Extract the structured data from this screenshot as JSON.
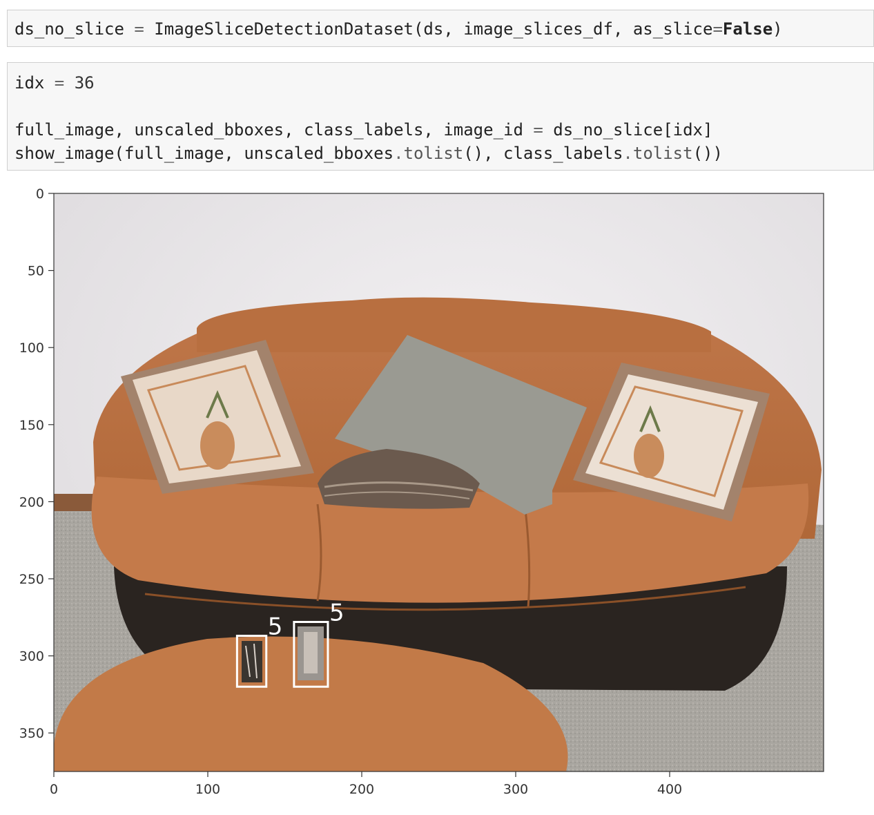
{
  "cells": [
    {
      "id": "cell1",
      "lines": [
        [
          {
            "t": "ds_no_slice "
          },
          {
            "t": "=",
            "c": "op"
          },
          {
            "t": " ImageSliceDetectionDataset(ds, image_slices_df, as_slice"
          },
          {
            "t": "=",
            "c": "op"
          },
          {
            "t": "False",
            "c": "kw"
          },
          {
            "t": ")"
          }
        ]
      ]
    },
    {
      "id": "cell2",
      "lines": [
        [
          {
            "t": "idx "
          },
          {
            "t": "=",
            "c": "op"
          },
          {
            "t": " 36",
            "c": "num"
          }
        ],
        [],
        [
          {
            "t": "full_image, unscaled_bboxes, class_labels, image_id "
          },
          {
            "t": "=",
            "c": "op"
          },
          {
            "t": " ds_no_slice[idx]"
          }
        ],
        [
          {
            "t": "show_image(full_image, unscaled_bboxes"
          },
          {
            "t": ".",
            "c": "op"
          },
          {
            "t": "tolist",
            "c": "fn"
          },
          {
            "t": "(), class_labels"
          },
          {
            "t": ".",
            "c": "op"
          },
          {
            "t": "tolist",
            "c": "fn"
          },
          {
            "t": "())"
          }
        ]
      ]
    }
  ],
  "plot": {
    "x_ticks": [
      0,
      100,
      200,
      300,
      400
    ],
    "y_ticks": [
      0,
      50,
      100,
      150,
      200,
      250,
      300,
      350
    ],
    "xlim": [
      0,
      500
    ],
    "ylim": [
      375,
      0
    ],
    "bboxes": [
      {
        "label": "5",
        "x0": 119,
        "y0": 287,
        "x1": 138,
        "y1": 320
      },
      {
        "label": "5",
        "x0": 156,
        "y0": 278,
        "x1": 178,
        "y1": 320
      }
    ]
  }
}
